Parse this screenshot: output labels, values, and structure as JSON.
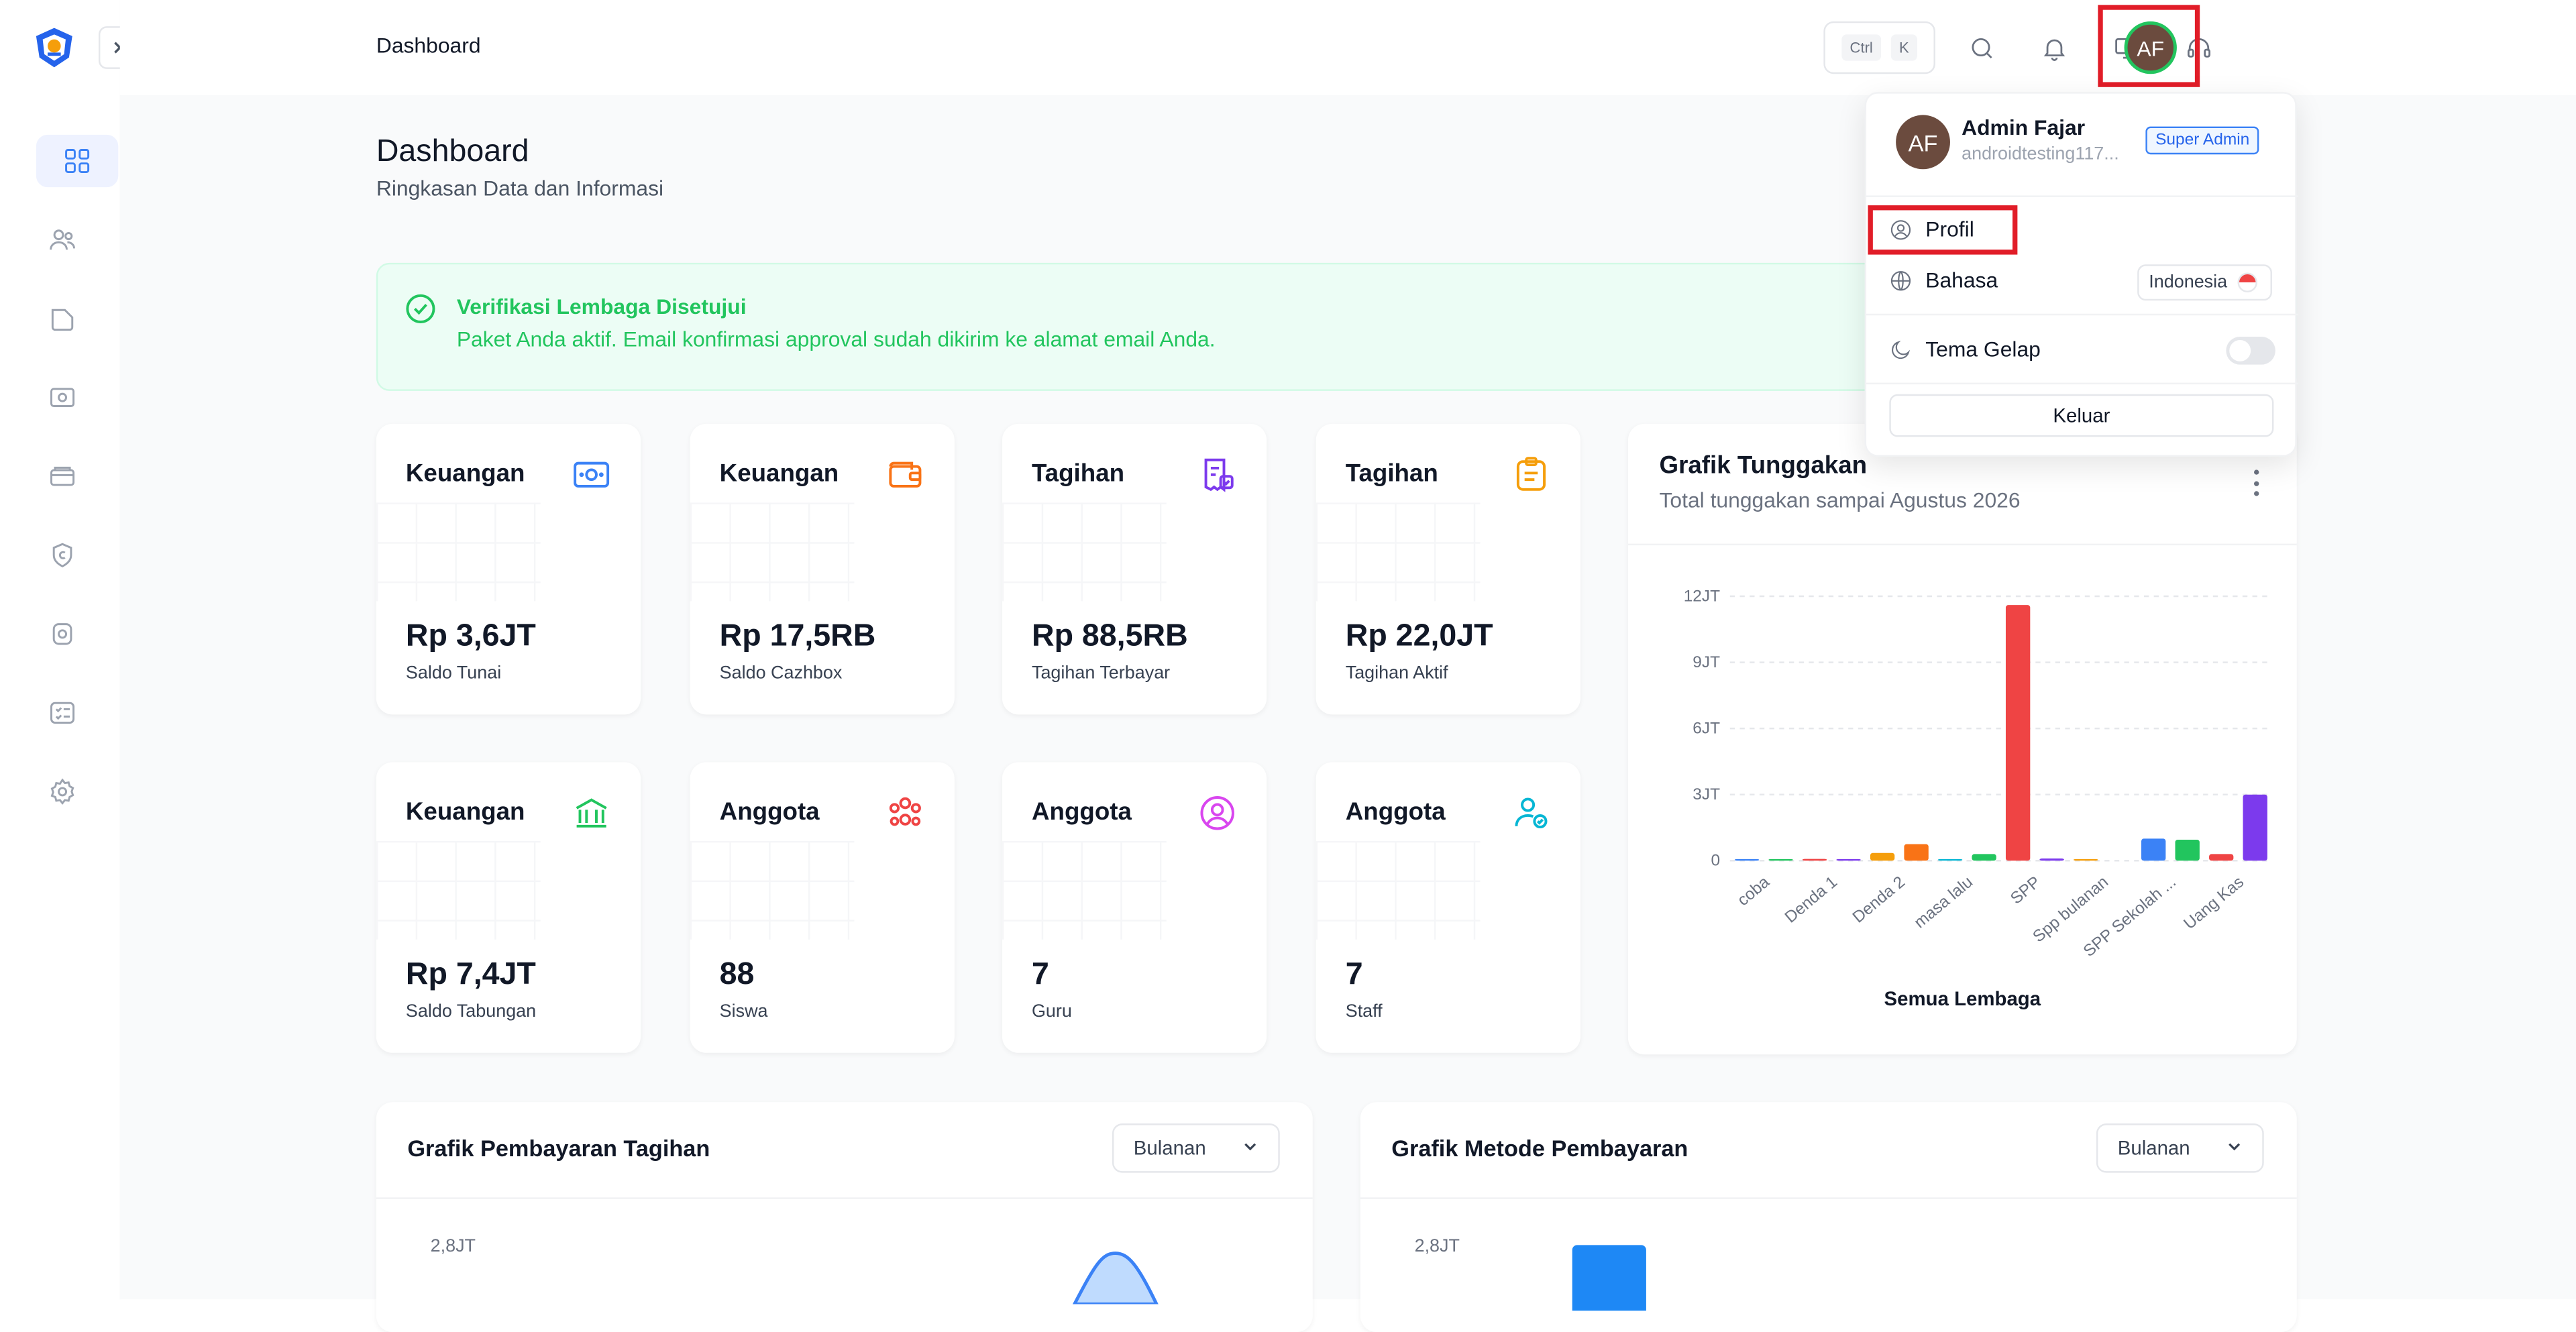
{
  "topbar": {
    "title": "Dashboard",
    "shortcut_ctrl": "Ctrl",
    "shortcut_k": "K",
    "avatar_initials": "AF",
    "icons": [
      "search-icon",
      "bell-icon",
      "monitor-icon",
      "headset-icon"
    ]
  },
  "sidebar": {
    "items": [
      {
        "name": "dashboard",
        "icon": "grid-icon",
        "active": true
      },
      {
        "name": "users",
        "icon": "users-icon",
        "active": false
      },
      {
        "name": "folder",
        "icon": "folder-icon",
        "active": false
      },
      {
        "name": "money",
        "icon": "banknote-icon",
        "active": false
      },
      {
        "name": "wallet",
        "icon": "wallet-icon",
        "active": false
      },
      {
        "name": "badge",
        "icon": "badge-icon",
        "active": false
      },
      {
        "name": "safe",
        "icon": "safe-icon",
        "active": false
      },
      {
        "name": "checklist",
        "icon": "checklist-icon",
        "active": false
      },
      {
        "name": "settings",
        "icon": "gear-icon",
        "active": false
      }
    ]
  },
  "page": {
    "title": "Dashboard",
    "subtitle": "Ringkasan Data dan Informasi"
  },
  "alert": {
    "title": "Verifikasi Lembaga Disetujui",
    "text": "Paket Anda aktif. Email konfirmasi approval sudah dikirim ke alamat email Anda."
  },
  "cards": [
    {
      "label": "Keuangan",
      "value": "Rp 3,6JT",
      "sub": "Saldo Tunai",
      "icon": "banknote-icon",
      "color": "#3b82f6"
    },
    {
      "label": "Keuangan",
      "value": "Rp 17,5RB",
      "sub": "Saldo Cazhbox",
      "icon": "wallet-icon",
      "color": "#f97316"
    },
    {
      "label": "Tagihan",
      "value": "Rp 88,5RB",
      "sub": "Tagihan Terbayar",
      "icon": "receipt-check-icon",
      "color": "#7c3aed"
    },
    {
      "label": "Tagihan",
      "value": "Rp 22,0JT",
      "sub": "Tagihan Aktif",
      "icon": "clipboard-icon",
      "color": "#f59e0b"
    },
    {
      "label": "Keuangan",
      "value": "Rp 7,4JT",
      "sub": "Saldo Tabungan",
      "icon": "bank-icon",
      "color": "#22c55e"
    },
    {
      "label": "Anggota",
      "value": "88",
      "sub": "Siswa",
      "icon": "users-group-icon",
      "color": "#ef4444"
    },
    {
      "label": "Anggota",
      "value": "7",
      "sub": "Guru",
      "icon": "user-circle-icon",
      "color": "#d946ef"
    },
    {
      "label": "Anggota",
      "value": "7",
      "sub": "Staff",
      "icon": "user-check-icon",
      "color": "#06b6d4"
    }
  ],
  "arrears_chart": {
    "title": "Grafik Tunggakan",
    "subtitle": "Total tunggakan sampai Agustus 2026",
    "footer": "Semua Lembaga"
  },
  "chart_data": {
    "type": "bar",
    "yticks": [
      "12JT",
      "9JT",
      "6JT",
      "3JT",
      "0"
    ],
    "ylim": [
      0,
      12000000
    ],
    "xtick_labels": [
      "coba",
      "Denda 1",
      "Denda 2",
      "masa lalu",
      "SPP",
      "Spp bulanan",
      "SPP Sekolah ...",
      "Uang Kas"
    ],
    "values": [
      50000,
      30000,
      80000,
      60000,
      350000,
      750000,
      40000,
      300000,
      11600000,
      100000,
      60000,
      0,
      1000000,
      950000,
      300000,
      3000000
    ],
    "colors": [
      "#3b82f6",
      "#22c55e",
      "#ef4444",
      "#7c3aed",
      "#f59e0b",
      "#f97316",
      "#06b6d4",
      "#22c55e",
      "#ef4444",
      "#7c3aed",
      "#f59e0b",
      "#f97316",
      "#3b82f6",
      "#22c55e",
      "#ef4444",
      "#7c3aed"
    ],
    "grid": true
  },
  "payment_chart": {
    "title": "Grafik Pembayaran Tagihan",
    "period": "Bulanan",
    "ytick_top": "2,8JT"
  },
  "method_chart": {
    "title": "Grafik Metode Pembayaran",
    "period": "Bulanan",
    "ytick_top": "2,8JT"
  },
  "dropdown": {
    "avatar_initials": "AF",
    "name": "Admin Fajar",
    "email": "androidtesting117...",
    "role": "Super Admin",
    "profile_label": "Profil",
    "language_label": "Bahasa",
    "language_value": "Indonesia",
    "theme_label": "Tema Gelap",
    "logout_label": "Keluar"
  }
}
